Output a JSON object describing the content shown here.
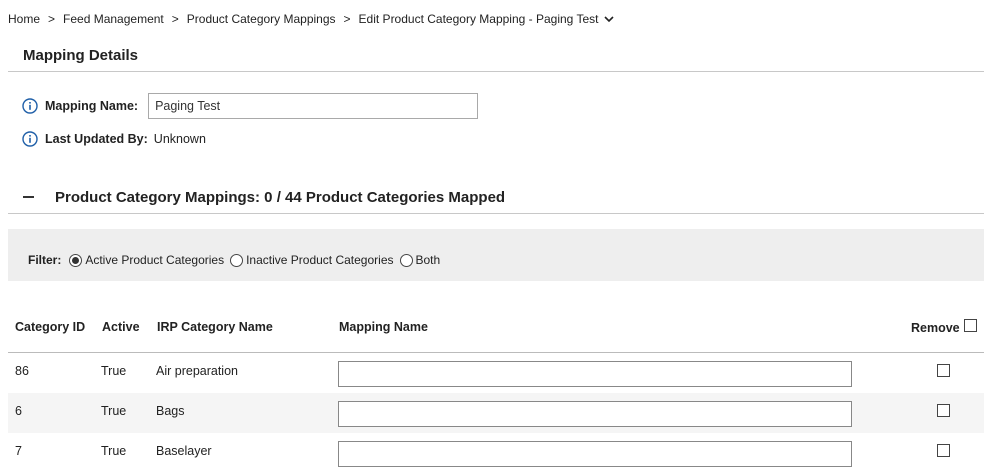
{
  "breadcrumb": {
    "items": [
      "Home",
      "Feed Management",
      "Product Category Mappings",
      "Edit Product Category Mapping - Paging Test"
    ],
    "separator": ">"
  },
  "mapping_details": {
    "title": "Mapping Details",
    "name_label": "Mapping Name:",
    "name_value": "Paging Test",
    "updated_label": "Last Updated By:",
    "updated_value": "Unknown"
  },
  "pcm": {
    "title": "Product Category Mappings: 0 / 44 Product Categories Mapped"
  },
  "filter": {
    "label": "Filter:",
    "options": [
      "Active Product Categories",
      "Inactive Product Categories",
      "Both"
    ],
    "selected": "Active Product Categories"
  },
  "table": {
    "headers": [
      "Category ID",
      "Active",
      "IRP Category Name",
      "Mapping Name",
      "Remove"
    ],
    "rows": [
      {
        "id": "86",
        "active": "True",
        "name": "Air preparation",
        "mapping": ""
      },
      {
        "id": "6",
        "active": "True",
        "name": "Bags",
        "mapping": ""
      },
      {
        "id": "7",
        "active": "True",
        "name": "Baselayer",
        "mapping": ""
      }
    ]
  },
  "colors": {
    "info_icon": "#1f5fa8",
    "filter_bg": "#eeeeee",
    "row_alt": "#f5f5f5"
  }
}
